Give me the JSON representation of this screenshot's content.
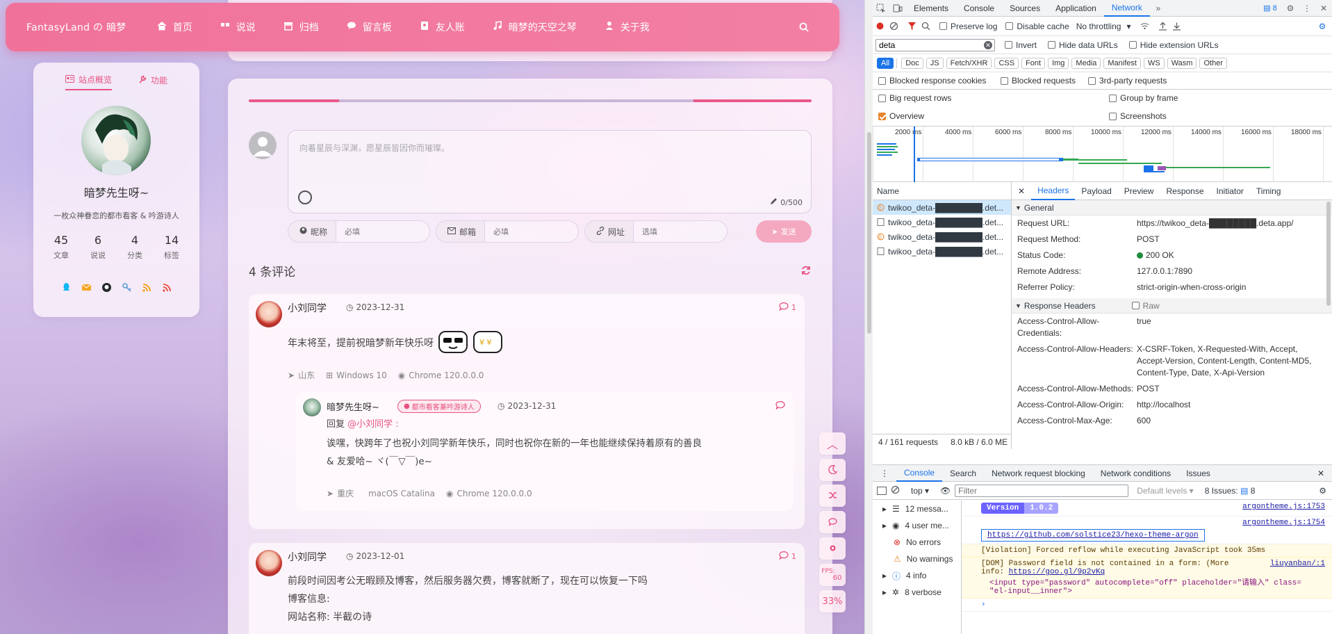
{
  "blog": {
    "brand": "FantasyLand の 暗梦",
    "nav": [
      "首页",
      "说说",
      "归档",
      "留言板",
      "友人账",
      "暗梦的天空之琴",
      "关于我"
    ],
    "sidebar": {
      "tab_overview": "站点概览",
      "tab_features": "功能",
      "author": "暗梦先生呀~",
      "description": "一枚众神眷恋的都市看客 & 吟游诗人",
      "stats": [
        {
          "value": "45",
          "label": "文章"
        },
        {
          "value": "6",
          "label": "说说"
        },
        {
          "value": "4",
          "label": "分类"
        },
        {
          "value": "14",
          "label": "标签"
        }
      ]
    },
    "comment_form": {
      "placeholder": "向着星辰与深渊，愿星辰皆因你而璀璨。",
      "counter": "0/500",
      "nick_label": "昵称",
      "nick_placeholder": "必填",
      "mail_label": "邮箱",
      "mail_placeholder": "必填",
      "url_label": "网址",
      "url_placeholder": "选填",
      "submit": "发送"
    },
    "comment_count": "4 条评论",
    "comments": [
      {
        "name": "小刘同学",
        "date": "2023-12-31",
        "replies": "1",
        "text": "年末将至，提前祝暗梦新年快乐呀",
        "location": "山东",
        "os": "Windows 10",
        "browser": "Chrome 120.0.0.0",
        "reply": {
          "name": "暗梦先生呀~",
          "badge": "都市看客兼吟游诗人",
          "date": "2023-12-31",
          "reply_to_prefix": "回复",
          "reply_to": "@小刘同学 :",
          "text_line1": "诶嘿，快跨年了也祝小刘同学新年快乐，同时也祝你在新的一年也能继续保持着原有的善良",
          "text_line2": "& 友爱哈~ ヾ(￣▽￣)e~",
          "location": "重庆",
          "os": "macOS Catalina",
          "browser": "Chrome 120.0.0.0"
        }
      },
      {
        "name": "小刘同学",
        "date": "2023-12-01",
        "replies": "1",
        "line1": "前段时间因考公无暇顾及博客，然后服务器欠费，博客就断了，现在可以恢复一下吗",
        "line2": "博客信息:",
        "line3": "网站名称: 半截の诗"
      }
    ],
    "fps_label": "FPS:",
    "fps_value": "60",
    "scroll_percent": "33%"
  },
  "devtools": {
    "tabs": [
      "Elements",
      "Console",
      "Sources",
      "Application",
      "Network"
    ],
    "active_tab": "Network",
    "issues_badge": "8",
    "toolbar": {
      "preserve_log": "Preserve log",
      "disable_cache": "Disable cache",
      "throttling": "No throttling"
    },
    "filter": {
      "value": "deta",
      "invert": "Invert",
      "hide_data_urls": "Hide data URLs",
      "hide_extension_urls": "Hide extension URLs"
    },
    "type_chips": [
      "All",
      "Doc",
      "JS",
      "Fetch/XHR",
      "CSS",
      "Font",
      "Img",
      "Media",
      "Manifest",
      "WS",
      "Wasm",
      "Other"
    ],
    "options": {
      "blocked_response_cookies": "Blocked response cookies",
      "blocked_requests": "Blocked requests",
      "third_party": "3rd-party requests",
      "big_request_rows": "Big request rows",
      "group_by_frame": "Group by frame",
      "overview": "Overview",
      "screenshots": "Screenshots"
    },
    "timeline_ticks": [
      "2000 ms",
      "4000 ms",
      "6000 ms",
      "8000 ms",
      "10000 ms",
      "12000 ms",
      "14000 ms",
      "16000 ms",
      "18000 ms"
    ],
    "list_header": "Name",
    "requests": [
      "twikoo_deta-████████.det...",
      "twikoo_deta-████████.det...",
      "twikoo_deta-████████.det...",
      "twikoo_deta-████████.det..."
    ],
    "footer": {
      "requests": "4 / 161 requests",
      "transferred": "8.0 kB / 6.0 ME"
    },
    "detail_tabs": [
      "Headers",
      "Payload",
      "Preview",
      "Response",
      "Initiator",
      "Timing"
    ],
    "general_title": "General",
    "general": [
      {
        "k": "Request URL:",
        "v": "https://twikoo_deta-████████.deta.app/"
      },
      {
        "k": "Request Method:",
        "v": "POST"
      },
      {
        "k": "Status Code:",
        "v": "200 OK"
      },
      {
        "k": "Remote Address:",
        "v": "127.0.0.1:7890"
      },
      {
        "k": "Referrer Policy:",
        "v": "strict-origin-when-cross-origin"
      }
    ],
    "response_headers_title": "Response Headers",
    "raw_label": "Raw",
    "response_headers": [
      {
        "k": "Access-Control-Allow-Credentials:",
        "v": "true"
      },
      {
        "k": "Access-Control-Allow-Headers:",
        "v": "X-CSRF-Token, X-Requested-With, Accept, Accept-Version, Content-Length, Content-MD5, Content-Type, Date, X-Api-Version"
      },
      {
        "k": "Access-Control-Allow-Methods:",
        "v": "POST"
      },
      {
        "k": "Access-Control-Allow-Origin:",
        "v": "http://localhost"
      },
      {
        "k": "Access-Control-Max-Age:",
        "v": "600"
      }
    ],
    "drawer_tabs": [
      "Console",
      "Search",
      "Network request blocking",
      "Network conditions",
      "Issues"
    ],
    "console_context": "top",
    "console_filter_placeholder": "Filter",
    "default_levels": "Default levels",
    "issues_count": "8 Issues:",
    "issues_num": "8",
    "console_sidebar": [
      {
        "label": "12 messa..."
      },
      {
        "label": "4 user me..."
      },
      {
        "label": "No errors"
      },
      {
        "label": "No warnings"
      },
      {
        "label": "4 info"
      },
      {
        "label": "8 verbose"
      }
    ],
    "console_messages": {
      "version_label": "Version",
      "version_value": "1.0.2",
      "src1": "argontheme.js:1753",
      "src2": "argontheme.js:1754",
      "link": "https://github.com/solstice23/hexo-theme-argon",
      "violation": "[Violation] Forced reflow while executing JavaScript took 35ms",
      "dom_line1": "[DOM] Password field is not contained in a form: (More",
      "dom_src": "liuyanban/:1",
      "dom_line2_prefix": "info:",
      "dom_line2_link": "https://goo.gl/9p2vKq",
      "dom_line3": "<input type=\"password\" autocomplete=\"off\" placeholder=\"请输入\" class=",
      "dom_line4": "\"el-input__inner\">"
    }
  }
}
